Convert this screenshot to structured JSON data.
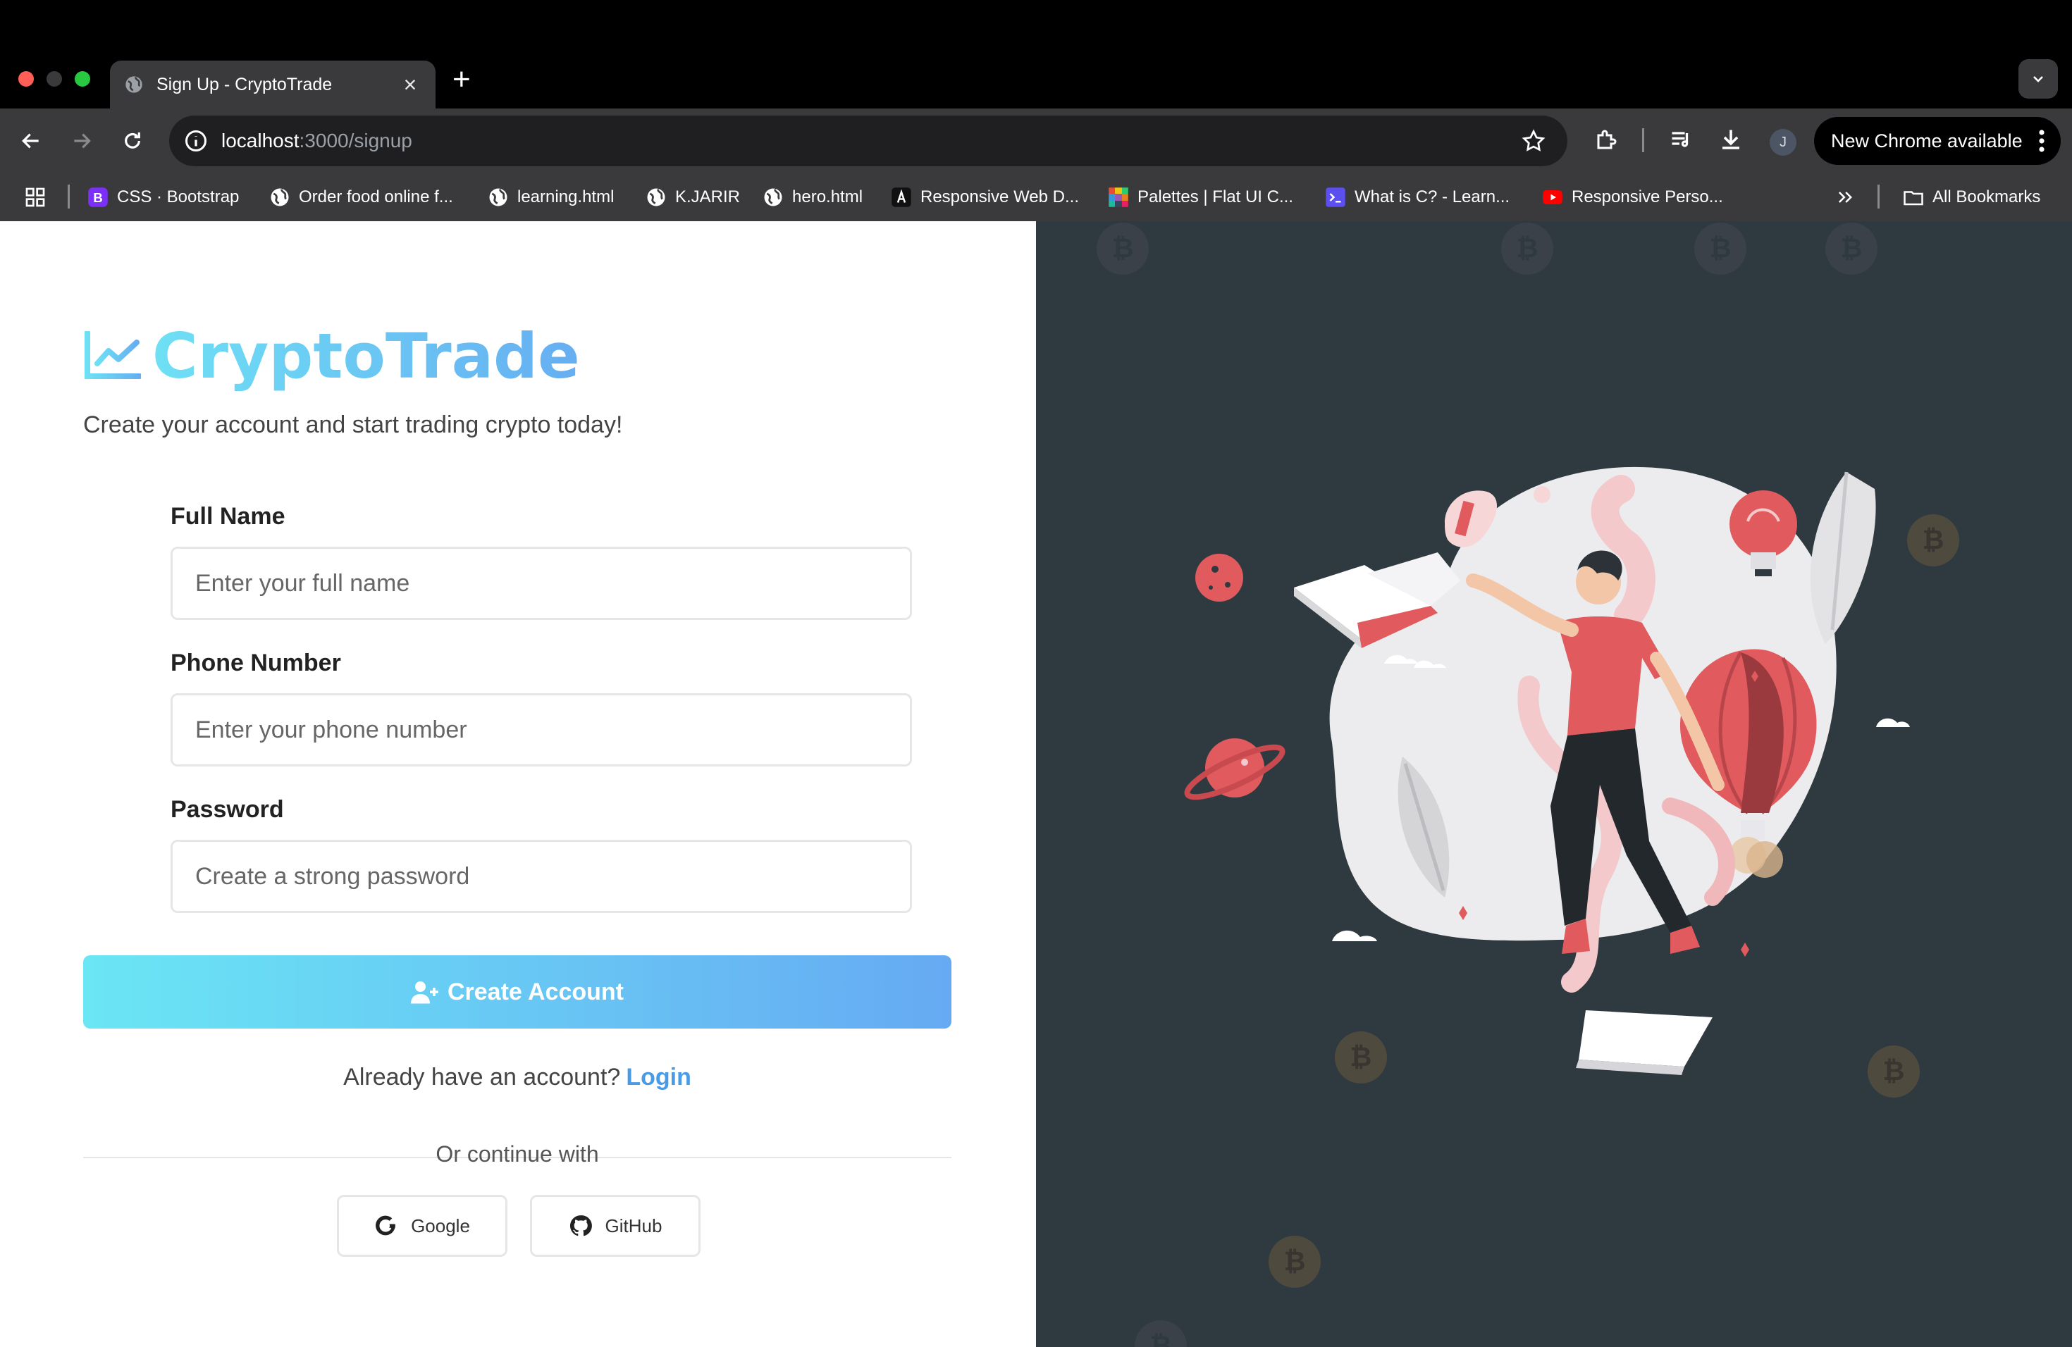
{
  "browser": {
    "tab_title": "Sign Up - CryptoTrade",
    "url_host": "localhost",
    "url_path": ":3000/signup",
    "profile_initial": "J",
    "update_label": "New Chrome available",
    "bookmarks": [
      {
        "label": "CSS · Bootstrap",
        "icon": "bootstrap-icon"
      },
      {
        "label": "Order food online f...",
        "icon": "globe-icon"
      },
      {
        "label": "learning.html",
        "icon": "globe-icon"
      },
      {
        "label": "K.JARIR",
        "icon": "globe-icon"
      },
      {
        "label": "hero.html",
        "icon": "globe-icon"
      },
      {
        "label": "Responsive Web D...",
        "icon": "angular-icon"
      },
      {
        "label": "Palettes | Flat UI C...",
        "icon": "palette-icon"
      },
      {
        "label": "What is C? - Learn...",
        "icon": "terminal-icon"
      },
      {
        "label": "Responsive Perso...",
        "icon": "youtube-icon"
      }
    ],
    "all_bookmarks_label": "All Bookmarks"
  },
  "signup": {
    "brand": "CryptoTrade",
    "tagline": "Create your account and start trading crypto today!",
    "full_name_label": "Full Name",
    "full_name_placeholder": "Enter your full name",
    "phone_label": "Phone Number",
    "phone_placeholder": "Enter your phone number",
    "password_label": "Password",
    "password_placeholder": "Create a strong password",
    "create_button": "Create Account",
    "have_account_text": "Already have an account?",
    "login_link": "Login",
    "or_text": "Or continue with",
    "google_label": "Google",
    "github_label": "GitHub"
  },
  "colors": {
    "brand_gradient_start": "#6ee0f4",
    "brand_gradient_end": "#66aef2",
    "illustration_bg": "#2f3a40",
    "accent_red": "#e05a5e"
  }
}
